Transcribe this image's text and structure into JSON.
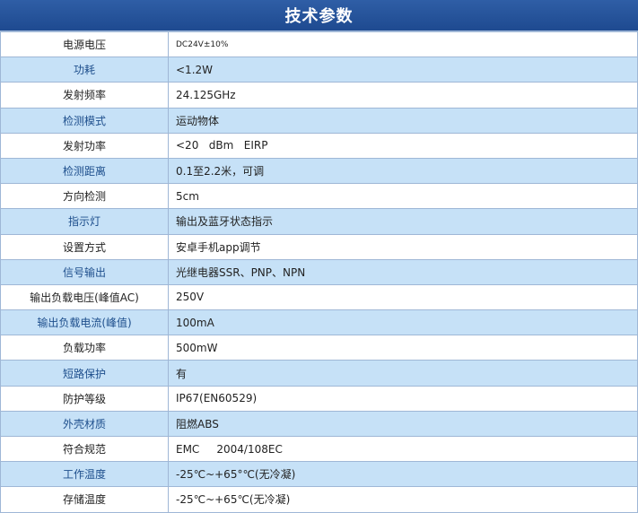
{
  "title": "技术参数",
  "rows": [
    {
      "label": "电源电压",
      "value": "DC24V±10%"
    },
    {
      "label": "功耗",
      "value": "<1.2W"
    },
    {
      "label": "发射频率",
      "value": "24.125GHz"
    },
    {
      "label": "检测模式",
      "value": "运动物体"
    },
    {
      "label": "发射功率",
      "value": "<20   dBm   EIRP"
    },
    {
      "label": "检测距离",
      "value": "0.1至2.2米，可调"
    },
    {
      "label": "方向检测",
      "value": "5cm"
    },
    {
      "label": "指示灯",
      "value": "输出及蓝牙状态指示"
    },
    {
      "label": "设置方式",
      "value": "安卓手机app调节"
    },
    {
      "label": "信号输出",
      "value": "光继电器SSR、PNP、NPN"
    },
    {
      "label": "输出负载电压(峰值AC)",
      "value": "250V"
    },
    {
      "label": "输出负载电流(峰值)",
      "value": "100mA"
    },
    {
      "label": "负载功率",
      "value": "500mW"
    },
    {
      "label": "短路保护",
      "value": "有"
    },
    {
      "label": "防护等级",
      "value": "IP67(EN60529)"
    },
    {
      "label": "外壳材质",
      "value": "阻燃ABS"
    },
    {
      "label": "符合规范",
      "value": "EMC     2004/108EC"
    },
    {
      "label": "工作温度",
      "value": "-25℃~+65°℃(无冷凝)"
    },
    {
      "label": "存储温度",
      "value": "-25℃~+65℃(无冷凝)"
    }
  ]
}
